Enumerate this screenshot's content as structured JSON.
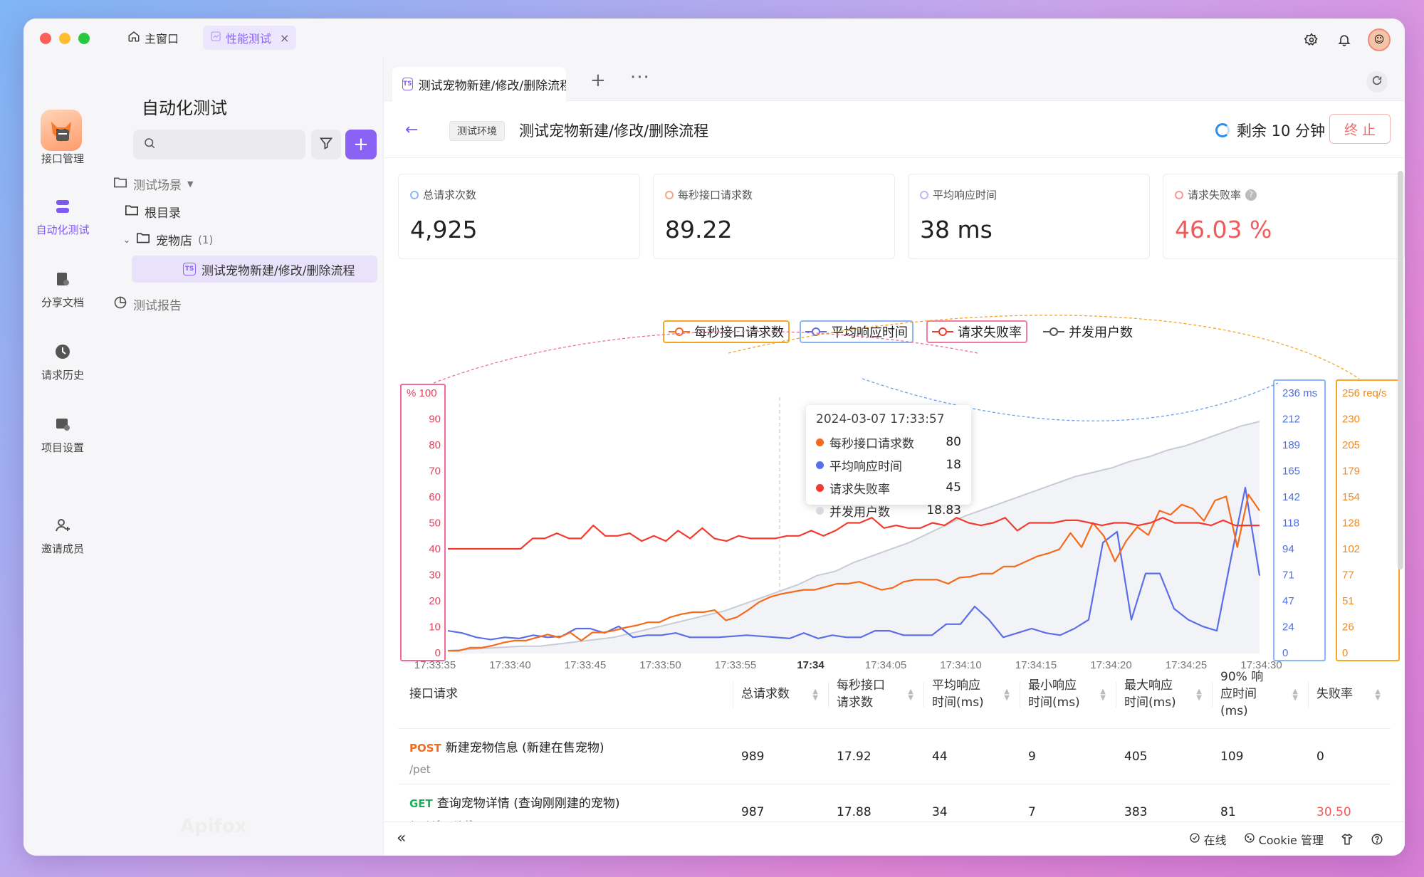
{
  "titlebar": {
    "home_tab": "主窗口",
    "active_tab": "性能测试",
    "close": "×"
  },
  "rail": {
    "items": [
      {
        "label": "接口管理",
        "icon": "api-icon"
      },
      {
        "label": "自动化测试",
        "icon": "automation-icon"
      },
      {
        "label": "分享文档",
        "icon": "share-doc-icon"
      },
      {
        "label": "请求历史",
        "icon": "history-icon"
      },
      {
        "label": "项目设置",
        "icon": "settings-icon"
      },
      {
        "label": "邀请成员",
        "icon": "invite-icon"
      }
    ]
  },
  "sidebar": {
    "title": "自动化测试",
    "search_placeholder": "",
    "tree": {
      "scenes": "测试场景",
      "root": "根目录",
      "folder": "宠物店",
      "folder_count": "(1)",
      "item": "测试宠物新建/修改/删除流程",
      "reports": "测试报告"
    }
  },
  "tabs": {
    "doc_tab": "测试宠物新建/修改/删除流程",
    "plus": "+",
    "more": "···"
  },
  "header": {
    "back": "←",
    "env": "测试环境",
    "title": "测试宠物新建/修改/删除流程",
    "remaining": "剩余 10 分钟",
    "stop": "终 止"
  },
  "stats": [
    {
      "label": "总请求次数",
      "value": "4,925",
      "color": "#4a90e2"
    },
    {
      "label": "每秒接口请求数",
      "value": "89.22",
      "color": "#f0883e"
    },
    {
      "label": "平均响应时间",
      "value": "38 ms",
      "color": "#9b7cf0"
    },
    {
      "label": "请求失败率",
      "value": "46.03 %",
      "color": "#f05a5a"
    }
  ],
  "chart_data": {
    "type": "line",
    "legend": [
      "每秒接口请求数",
      "平均响应时间",
      "请求失败率",
      "并发用户数"
    ],
    "x": [
      "17:33:35",
      "17:33:40",
      "17:33:45",
      "17:33:50",
      "17:33:55",
      "17:34",
      "17:34:05",
      "17:34:10",
      "17:34:15",
      "17:34:20",
      "17:34:25",
      "17:34:30"
    ],
    "left_axis": {
      "unit": "%",
      "ticks": [
        100,
        90,
        80,
        70,
        60,
        50,
        40,
        30,
        20,
        10,
        0
      ],
      "labels": [
        "% 100",
        "90",
        "80",
        "70",
        "60",
        "50",
        "40",
        "30",
        "20",
        "10",
        "0"
      ]
    },
    "right_axis_ms": {
      "unit": "ms",
      "ticks": [
        "236 ms",
        "212",
        "189",
        "165",
        "142",
        "118",
        "94",
        "71",
        "47",
        "24",
        "0"
      ]
    },
    "right_axis_req": {
      "unit": "req/s",
      "ticks": [
        "256 req/s",
        "230",
        "205",
        "179",
        "154",
        "128",
        "102",
        "77",
        "51",
        "26",
        "0"
      ]
    },
    "series": [
      {
        "name": "请求失败率",
        "color": "#f23a2f",
        "axis": "left",
        "values": [
          40,
          40,
          40,
          40,
          40,
          40,
          40,
          44,
          44,
          46,
          44,
          44,
          49,
          45,
          45,
          46,
          43,
          45,
          43,
          47,
          44,
          48,
          44,
          43,
          45,
          44,
          44,
          44,
          45,
          45,
          47,
          45,
          47,
          50,
          50,
          52,
          48,
          49,
          48,
          48,
          50,
          49,
          52,
          50,
          49,
          50,
          52,
          47,
          50,
          50,
          50,
          51,
          51,
          50,
          49,
          50,
          50,
          49,
          50,
          52,
          50,
          50,
          50,
          49,
          51,
          49,
          49,
          49
        ]
      },
      {
        "name": "每秒接口请求数",
        "color": "#f56a1b",
        "axis": "right_req",
        "values": [
          2,
          2,
          5,
          5,
          7,
          10,
          12,
          12,
          15,
          18,
          15,
          20,
          12,
          20,
          20,
          22,
          25,
          27,
          30,
          30,
          35,
          38,
          40,
          40,
          42,
          32,
          35,
          42,
          50,
          55,
          58,
          60,
          62,
          62,
          65,
          68,
          68,
          70,
          66,
          62,
          64,
          70,
          72,
          72,
          72,
          68,
          74,
          75,
          78,
          78,
          85,
          85,
          90,
          95,
          98,
          102,
          118,
          104,
          128,
          115,
          90,
          110,
          124,
          116,
          140,
          136,
          146,
          142,
          130,
          150,
          154,
          104,
          156,
          140
        ]
      },
      {
        "name": "平均响应时间",
        "color": "#5b6ee8",
        "axis": "right_ms",
        "values": [
          20,
          18,
          14,
          12,
          14,
          13,
          16,
          14,
          15,
          22,
          22,
          18,
          24,
          14,
          16,
          16,
          18,
          14,
          14,
          14,
          15,
          16,
          15,
          14,
          13,
          18,
          13,
          16,
          14,
          14,
          20,
          20,
          16,
          16,
          16,
          26,
          26,
          42,
          30,
          14,
          18,
          22,
          18,
          16,
          22,
          30,
          100,
          110,
          30,
          72,
          72,
          40,
          30,
          24,
          20,
          86,
          150,
          70
        ]
      },
      {
        "name": "并发用户数",
        "color": "#c8cbd6",
        "axis": "right_ms",
        "values": [
          2,
          3,
          4,
          5,
          6,
          6,
          8,
          10,
          12,
          14,
          18,
          22,
          26,
          30,
          34,
          38,
          44,
          50,
          56,
          62,
          70,
          74,
          82,
          88,
          94,
          100,
          108,
          116,
          124,
          130,
          136,
          142,
          148,
          154,
          160,
          164,
          168,
          174,
          178,
          184,
          188,
          194,
          200,
          206,
          210
        ]
      }
    ],
    "tooltip": {
      "time": "2024-03-07 17:33:57",
      "rows": [
        {
          "name": "每秒接口请求数",
          "value": "80",
          "color": "#f56a1b"
        },
        {
          "name": "平均响应时间",
          "value": "18",
          "color": "#5b6ee8"
        },
        {
          "name": "请求失败率",
          "value": "45",
          "color": "#f23a2f"
        },
        {
          "name": "并发用户数",
          "value": "18.83",
          "color": "#c8cbd6"
        }
      ]
    }
  },
  "table": {
    "headers": [
      "接口请求",
      "总请求数",
      "每秒接口请求数",
      "平均响应时间(ms)",
      "最小响应时间(ms)",
      "最大响应时间(ms)",
      "90% 响应时间(ms)",
      "失败率"
    ],
    "rows": [
      {
        "method": "POST",
        "method_color": "#f56a1b",
        "name": "新建宠物信息 (新建在售宠物)",
        "path": "/pet",
        "cells": [
          "989",
          "17.92",
          "44",
          "9",
          "405",
          "109",
          "0"
        ],
        "fail_color": "#222222"
      },
      {
        "method": "GET",
        "method_color": "#1fae5b",
        "name": "查询宠物详情 (查询刚刚建的宠物)",
        "path": "/pet/{petId}",
        "cells": [
          "987",
          "17.88",
          "34",
          "7",
          "383",
          "81",
          "30.50"
        ],
        "fail_color": "#f05a5a"
      }
    ]
  },
  "bottombar": {
    "collapse": "«",
    "online": "在线",
    "cookie": "Cookie 管理"
  },
  "watermark": "Apifox"
}
